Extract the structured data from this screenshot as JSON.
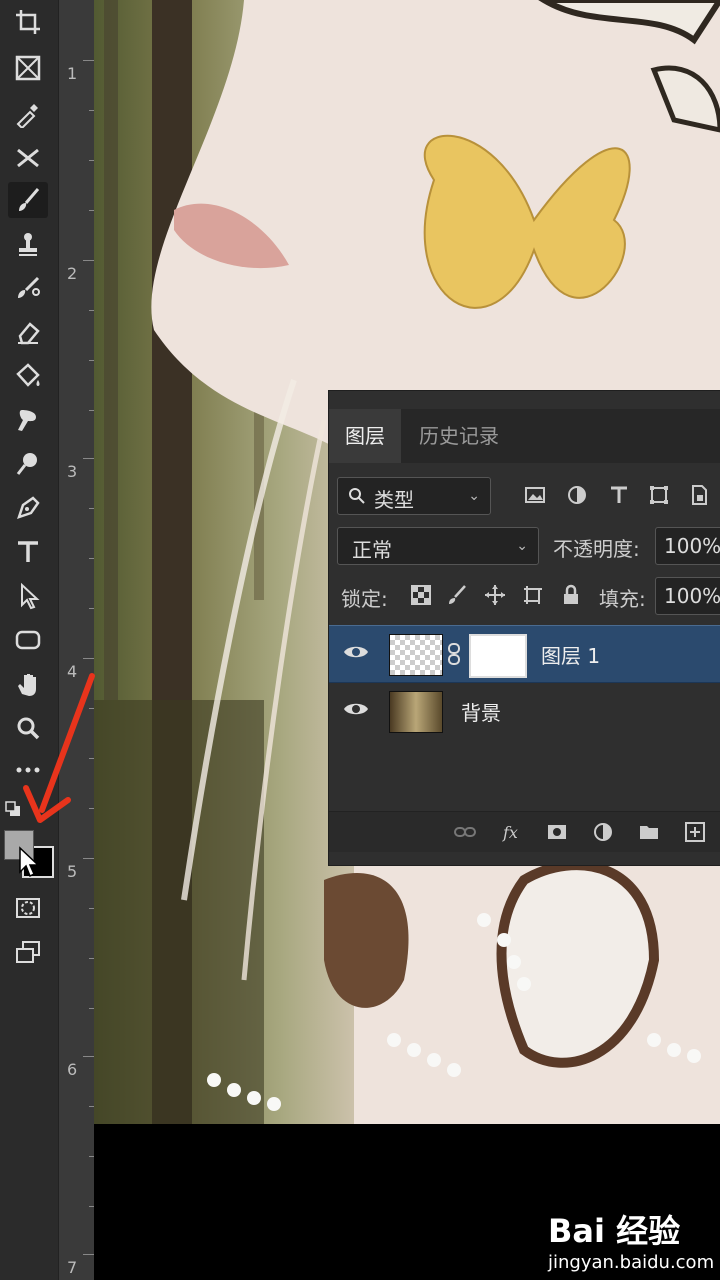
{
  "ruler": {
    "marks": [
      "1",
      "2",
      "3",
      "4",
      "5",
      "6",
      "7"
    ]
  },
  "panel": {
    "tabs": [
      {
        "label": "图层",
        "active": true
      },
      {
        "label": "历史记录",
        "active": false
      }
    ],
    "filter": {
      "label": "类型"
    },
    "blend_mode": "正常",
    "opacity_label": "不透明度:",
    "opacity_value": "100%",
    "lock_label": "锁定:",
    "fill_label": "填充:",
    "fill_value": "100%",
    "layers": [
      {
        "name": "图层 1",
        "selected": true
      },
      {
        "name": "背景",
        "selected": false
      }
    ]
  },
  "toolbar": {
    "tools": [
      "crop-icon",
      "frame-icon",
      "eyedropper-icon",
      "healing-icon",
      "brush-icon",
      "stamp-icon",
      "history-brush-icon",
      "eraser-icon",
      "paint-bucket-icon",
      "smudge-icon",
      "dodge-icon",
      "pen-icon",
      "type-icon",
      "path-select-icon",
      "shape-icon",
      "hand-icon",
      "zoom-icon",
      "more-icon"
    ],
    "foreground_color": "#a9a9a9",
    "background_color": "#000000"
  },
  "watermark": {
    "brand": "Bai 经验",
    "url": "jingyan.baidu.com"
  },
  "colors": {
    "accent": "#2b4a6e",
    "arrow": "#e8341c"
  }
}
